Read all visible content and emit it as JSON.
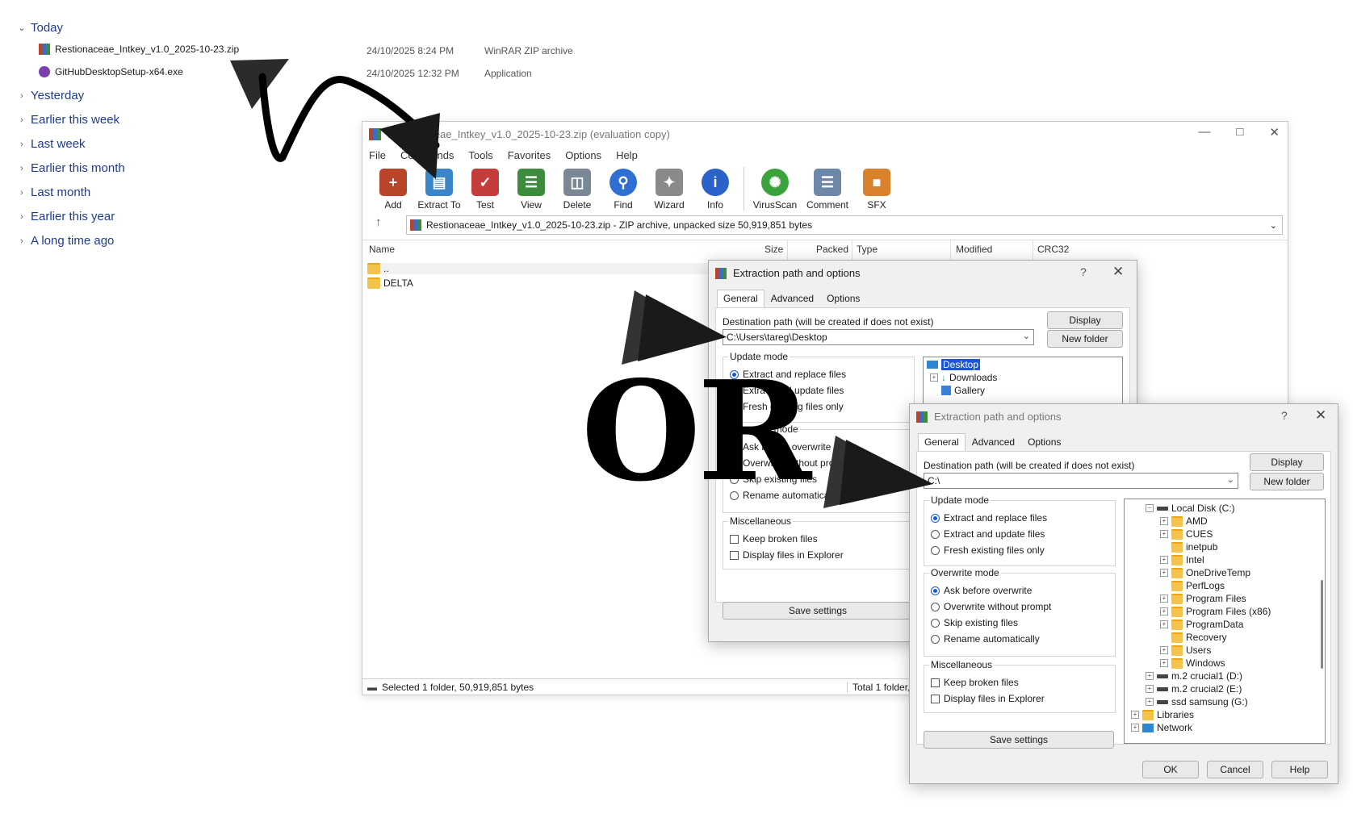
{
  "explorer": {
    "groups": [
      {
        "label": "Today",
        "expanded": true
      },
      {
        "label": "Yesterday"
      },
      {
        "label": "Earlier this week"
      },
      {
        "label": "Last week"
      },
      {
        "label": "Earlier this month"
      },
      {
        "label": "Last month"
      },
      {
        "label": "Earlier this year"
      },
      {
        "label": "A long time ago"
      }
    ],
    "files": [
      {
        "name": "Restionaceae_Intkey_v1.0_2025-10-23.zip",
        "date": "24/10/2025 8:24 PM",
        "type": "WinRAR ZIP archive",
        "icon": "winrar-zip-icon"
      },
      {
        "name": "GitHubDesktopSetup-x64.exe",
        "date": "24/10/2025 12:32 PM",
        "type": "Application",
        "icon": "github-desktop-icon"
      }
    ]
  },
  "winrar": {
    "title": "Restionaceae_Intkey_v1.0_2025-10-23.zip (evaluation copy)",
    "menu": [
      "File",
      "Commands",
      "Tools",
      "Favorites",
      "Options",
      "Help"
    ],
    "toolbar": [
      {
        "label": "Add",
        "icon": "add-archive-icon",
        "color": "#b8452a"
      },
      {
        "label": "Extract To",
        "icon": "extract-folder-icon",
        "color": "#3a86c8"
      },
      {
        "label": "Test",
        "icon": "test-clipboard-icon",
        "color": "#c43c3c"
      },
      {
        "label": "View",
        "icon": "view-book-icon",
        "color": "#3d8b3d"
      },
      {
        "label": "Delete",
        "icon": "trash-icon",
        "color": "#7a8794"
      },
      {
        "label": "Find",
        "icon": "magnifier-icon",
        "color": "#2e6fd1"
      },
      {
        "label": "Wizard",
        "icon": "magic-wand-icon",
        "color": "#8a8a8a"
      },
      {
        "label": "Info",
        "icon": "info-icon",
        "color": "#2a62c9"
      },
      {
        "label": "VirusScan",
        "icon": "virus-scan-icon",
        "color": "#3ca23c"
      },
      {
        "label": "Comment",
        "icon": "comment-icon",
        "color": "#6d87a8"
      },
      {
        "label": "SFX",
        "icon": "sfx-box-icon",
        "color": "#d9812b"
      }
    ],
    "path": "Restionaceae_Intkey_v1.0_2025-10-23.zip - ZIP archive, unpacked size 50,919,851 bytes",
    "columns": [
      "Name",
      "Size",
      "Packed",
      "Type",
      "Modified",
      "CRC32"
    ],
    "rows": [
      {
        "name": ".."
      },
      {
        "name": "DELTA"
      }
    ],
    "status_left": "Selected 1 folder, 50,919,851 bytes",
    "status_right": "Total 1 folder, 5"
  },
  "dialog1": {
    "title": "Extraction path and options",
    "tabs": [
      "General",
      "Advanced",
      "Options"
    ],
    "dest_label": "Destination path (will be created if does not exist)",
    "dest_value": "C:\\Users\\tareg\\Desktop",
    "display_btn": "Display",
    "new_folder_btn": "New folder",
    "update_mode_title": "Update mode",
    "update_modes": [
      "Extract and replace files",
      "Extract and update files",
      "Fresh existing files only"
    ],
    "overwrite_title": "Overwrite mode",
    "overwrite_modes": [
      "Ask before overwrite",
      "Overwrite without prompt",
      "Skip existing files",
      "Rename automatically"
    ],
    "misc_title": "Miscellaneous",
    "misc": [
      "Keep broken files",
      "Display files in Explorer"
    ],
    "save_btn": "Save settings",
    "tree": [
      "Desktop",
      "Downloads",
      "Gallery"
    ]
  },
  "dialog2": {
    "title": "Extraction path and options",
    "tabs": [
      "General",
      "Advanced",
      "Options"
    ],
    "dest_label": "Destination path (will be created if does not exist)",
    "dest_value": "C:\\",
    "display_btn": "Display",
    "new_folder_btn": "New folder",
    "update_mode_title": "Update mode",
    "update_modes": [
      "Extract and replace files",
      "Extract and update files",
      "Fresh existing files only"
    ],
    "overwrite_title": "Overwrite mode",
    "overwrite_modes": [
      "Ask before overwrite",
      "Overwrite without prompt",
      "Skip existing files",
      "Rename automatically"
    ],
    "misc_title": "Miscellaneous",
    "misc": [
      "Keep broken files",
      "Display files in Explorer"
    ],
    "save_btn": "Save settings",
    "ok_btn": "OK",
    "cancel_btn": "Cancel",
    "help_btn": "Help",
    "tree": [
      "Local Disk (C:)",
      "AMD",
      "CUES",
      "inetpub",
      "Intel",
      "OneDriveTemp",
      "PerfLogs",
      "Program Files",
      "Program Files (x86)",
      "ProgramData",
      "Recovery",
      "Users",
      "Windows",
      "m.2 crucial1 (D:)",
      "m.2 crucial2 (E:)",
      "ssd samsung (G:)",
      "Libraries",
      "Network"
    ]
  },
  "annotation": {
    "or_text": "OR"
  }
}
